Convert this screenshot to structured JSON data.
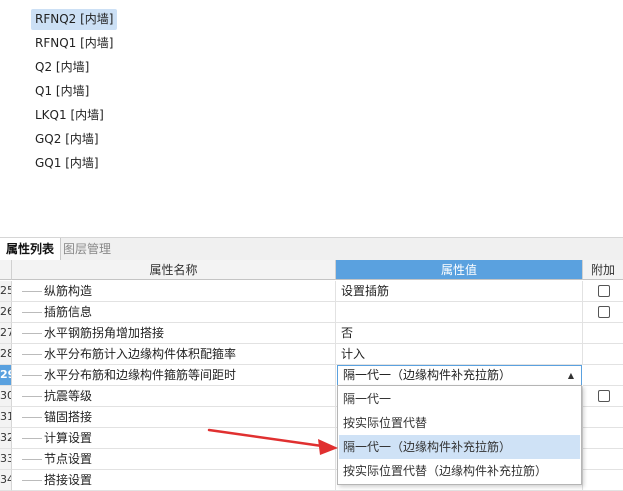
{
  "tree": {
    "items": [
      {
        "label": "RFNQ2 [内墙]",
        "selected": true
      },
      {
        "label": "RFNQ1 [内墙]"
      },
      {
        "label": "Q2 [内墙]"
      },
      {
        "label": "Q1 [内墙]"
      },
      {
        "label": "LKQ1 [内墙]"
      },
      {
        "label": "GQ2 [内墙]"
      },
      {
        "label": "GQ1 [内墙]"
      }
    ]
  },
  "tabs": [
    {
      "label": "属性列表",
      "active": true
    },
    {
      "label": "图层管理",
      "active": false
    }
  ],
  "grid": {
    "headers": {
      "name": "属性名称",
      "value": "属性值",
      "extra": "附加"
    },
    "rows": [
      {
        "num": "25",
        "name": "纵筋构造",
        "value": "设置插筋",
        "checkbox": true
      },
      {
        "num": "26",
        "name": "插筋信息",
        "value": "",
        "checkbox": true
      },
      {
        "num": "27",
        "name": "水平钢筋拐角增加搭接",
        "value": "否",
        "checkbox": false
      },
      {
        "num": "28",
        "name": "水平分布筋计入边缘构件体积配箍率",
        "value": "计入",
        "checkbox": false
      },
      {
        "num": "29",
        "name": "水平分布筋和边缘构件箍筋等间距时",
        "value": "隔一代一（边缘构件补充拉筋）",
        "checkbox": false,
        "current": true
      },
      {
        "num": "30",
        "name": "抗震等级",
        "value": "",
        "checkbox": true
      },
      {
        "num": "31",
        "name": "锚固搭接",
        "value": "",
        "checkbox": false
      },
      {
        "num": "32",
        "name": "计算设置",
        "value": "",
        "checkbox": false
      },
      {
        "num": "33",
        "name": "节点设置",
        "value": "",
        "checkbox": false
      },
      {
        "num": "34",
        "name": "搭接设置",
        "value": "",
        "checkbox": false
      }
    ]
  },
  "dropdown": {
    "options": [
      {
        "label": "隔一代一",
        "selected": false
      },
      {
        "label": "按实际位置代替",
        "selected": false
      },
      {
        "label": "隔一代一（边缘构件补充拉筋）",
        "selected": true
      },
      {
        "label": "按实际位置代替（边缘构件补充拉筋）",
        "selected": false
      }
    ]
  },
  "colors": {
    "accent": "#5aa1df",
    "selection": "#cfe2f6",
    "arrow": "#e03030"
  },
  "icons": {
    "combo_arrow": "triangle-up-icon",
    "pointer": "red-arrow-icon"
  }
}
